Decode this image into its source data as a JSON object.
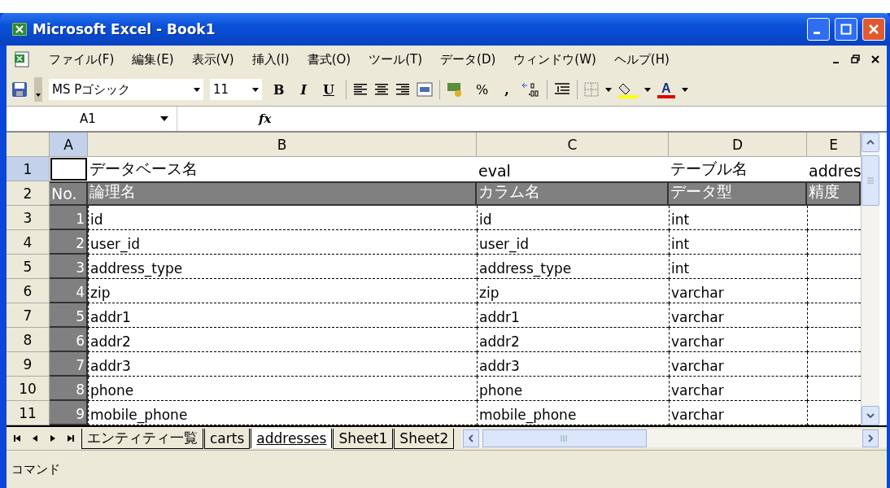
{
  "window": {
    "title": "Microsoft Excel - Book1"
  },
  "menu": [
    "ファイル(F)",
    "編集(E)",
    "表示(V)",
    "挿入(I)",
    "書式(O)",
    "ツール(T)",
    "データ(D)",
    "ウィンドウ(W)",
    "ヘルプ(H)"
  ],
  "toolbar": {
    "font_name": "MS Pゴシック",
    "font_size": "11",
    "bold": "B",
    "italic": "I",
    "underline": "U",
    "percent": "%",
    "comma": ",",
    "font_color": "A"
  },
  "formula_bar": {
    "name_box": "A1",
    "fx": "fx"
  },
  "grid": {
    "columns": [
      {
        "label": "A",
        "selected": true
      },
      {
        "label": "B",
        "selected": false
      },
      {
        "label": "C",
        "selected": false
      },
      {
        "label": "D",
        "selected": false
      },
      {
        "label": "E",
        "selected": false
      }
    ],
    "rows": [
      {
        "label": "1",
        "selected": true,
        "kind": "title",
        "cells": [
          "",
          "データベース名",
          "eval",
          "テーブル名",
          "addres"
        ]
      },
      {
        "label": "2",
        "selected": false,
        "kind": "header",
        "cells": [
          "No.",
          "論理名",
          "カラム名",
          "データ型",
          "精度"
        ]
      },
      {
        "label": "3",
        "selected": false,
        "kind": "data",
        "cells": [
          "1",
          "id",
          "id",
          "int",
          ""
        ]
      },
      {
        "label": "4",
        "selected": false,
        "kind": "data",
        "cells": [
          "2",
          "user_id",
          "user_id",
          "int",
          ""
        ]
      },
      {
        "label": "5",
        "selected": false,
        "kind": "data",
        "cells": [
          "3",
          "address_type",
          "address_type",
          "int",
          ""
        ]
      },
      {
        "label": "6",
        "selected": false,
        "kind": "data",
        "cells": [
          "4",
          "zip",
          "zip",
          "varchar",
          ""
        ]
      },
      {
        "label": "7",
        "selected": false,
        "kind": "data",
        "cells": [
          "5",
          "addr1",
          "addr1",
          "varchar",
          ""
        ]
      },
      {
        "label": "8",
        "selected": false,
        "kind": "data",
        "cells": [
          "6",
          "addr2",
          "addr2",
          "varchar",
          ""
        ]
      },
      {
        "label": "9",
        "selected": false,
        "kind": "data",
        "cells": [
          "7",
          "addr3",
          "addr3",
          "varchar",
          ""
        ]
      },
      {
        "label": "10",
        "selected": false,
        "kind": "data",
        "cells": [
          "8",
          "phone",
          "phone",
          "varchar",
          ""
        ]
      },
      {
        "label": "11",
        "selected": false,
        "kind": "data",
        "cells": [
          "9",
          "mobile_phone",
          "mobile_phone",
          "varchar",
          ""
        ]
      }
    ]
  },
  "sheet_tabs": [
    {
      "label": "エンティティ一覧",
      "selected": false
    },
    {
      "label": "carts",
      "selected": false
    },
    {
      "label": "addresses",
      "selected": true
    },
    {
      "label": "Sheet1",
      "selected": false
    },
    {
      "label": "Sheet2",
      "selected": false
    }
  ],
  "status_bar": {
    "text": "コマンド"
  }
}
